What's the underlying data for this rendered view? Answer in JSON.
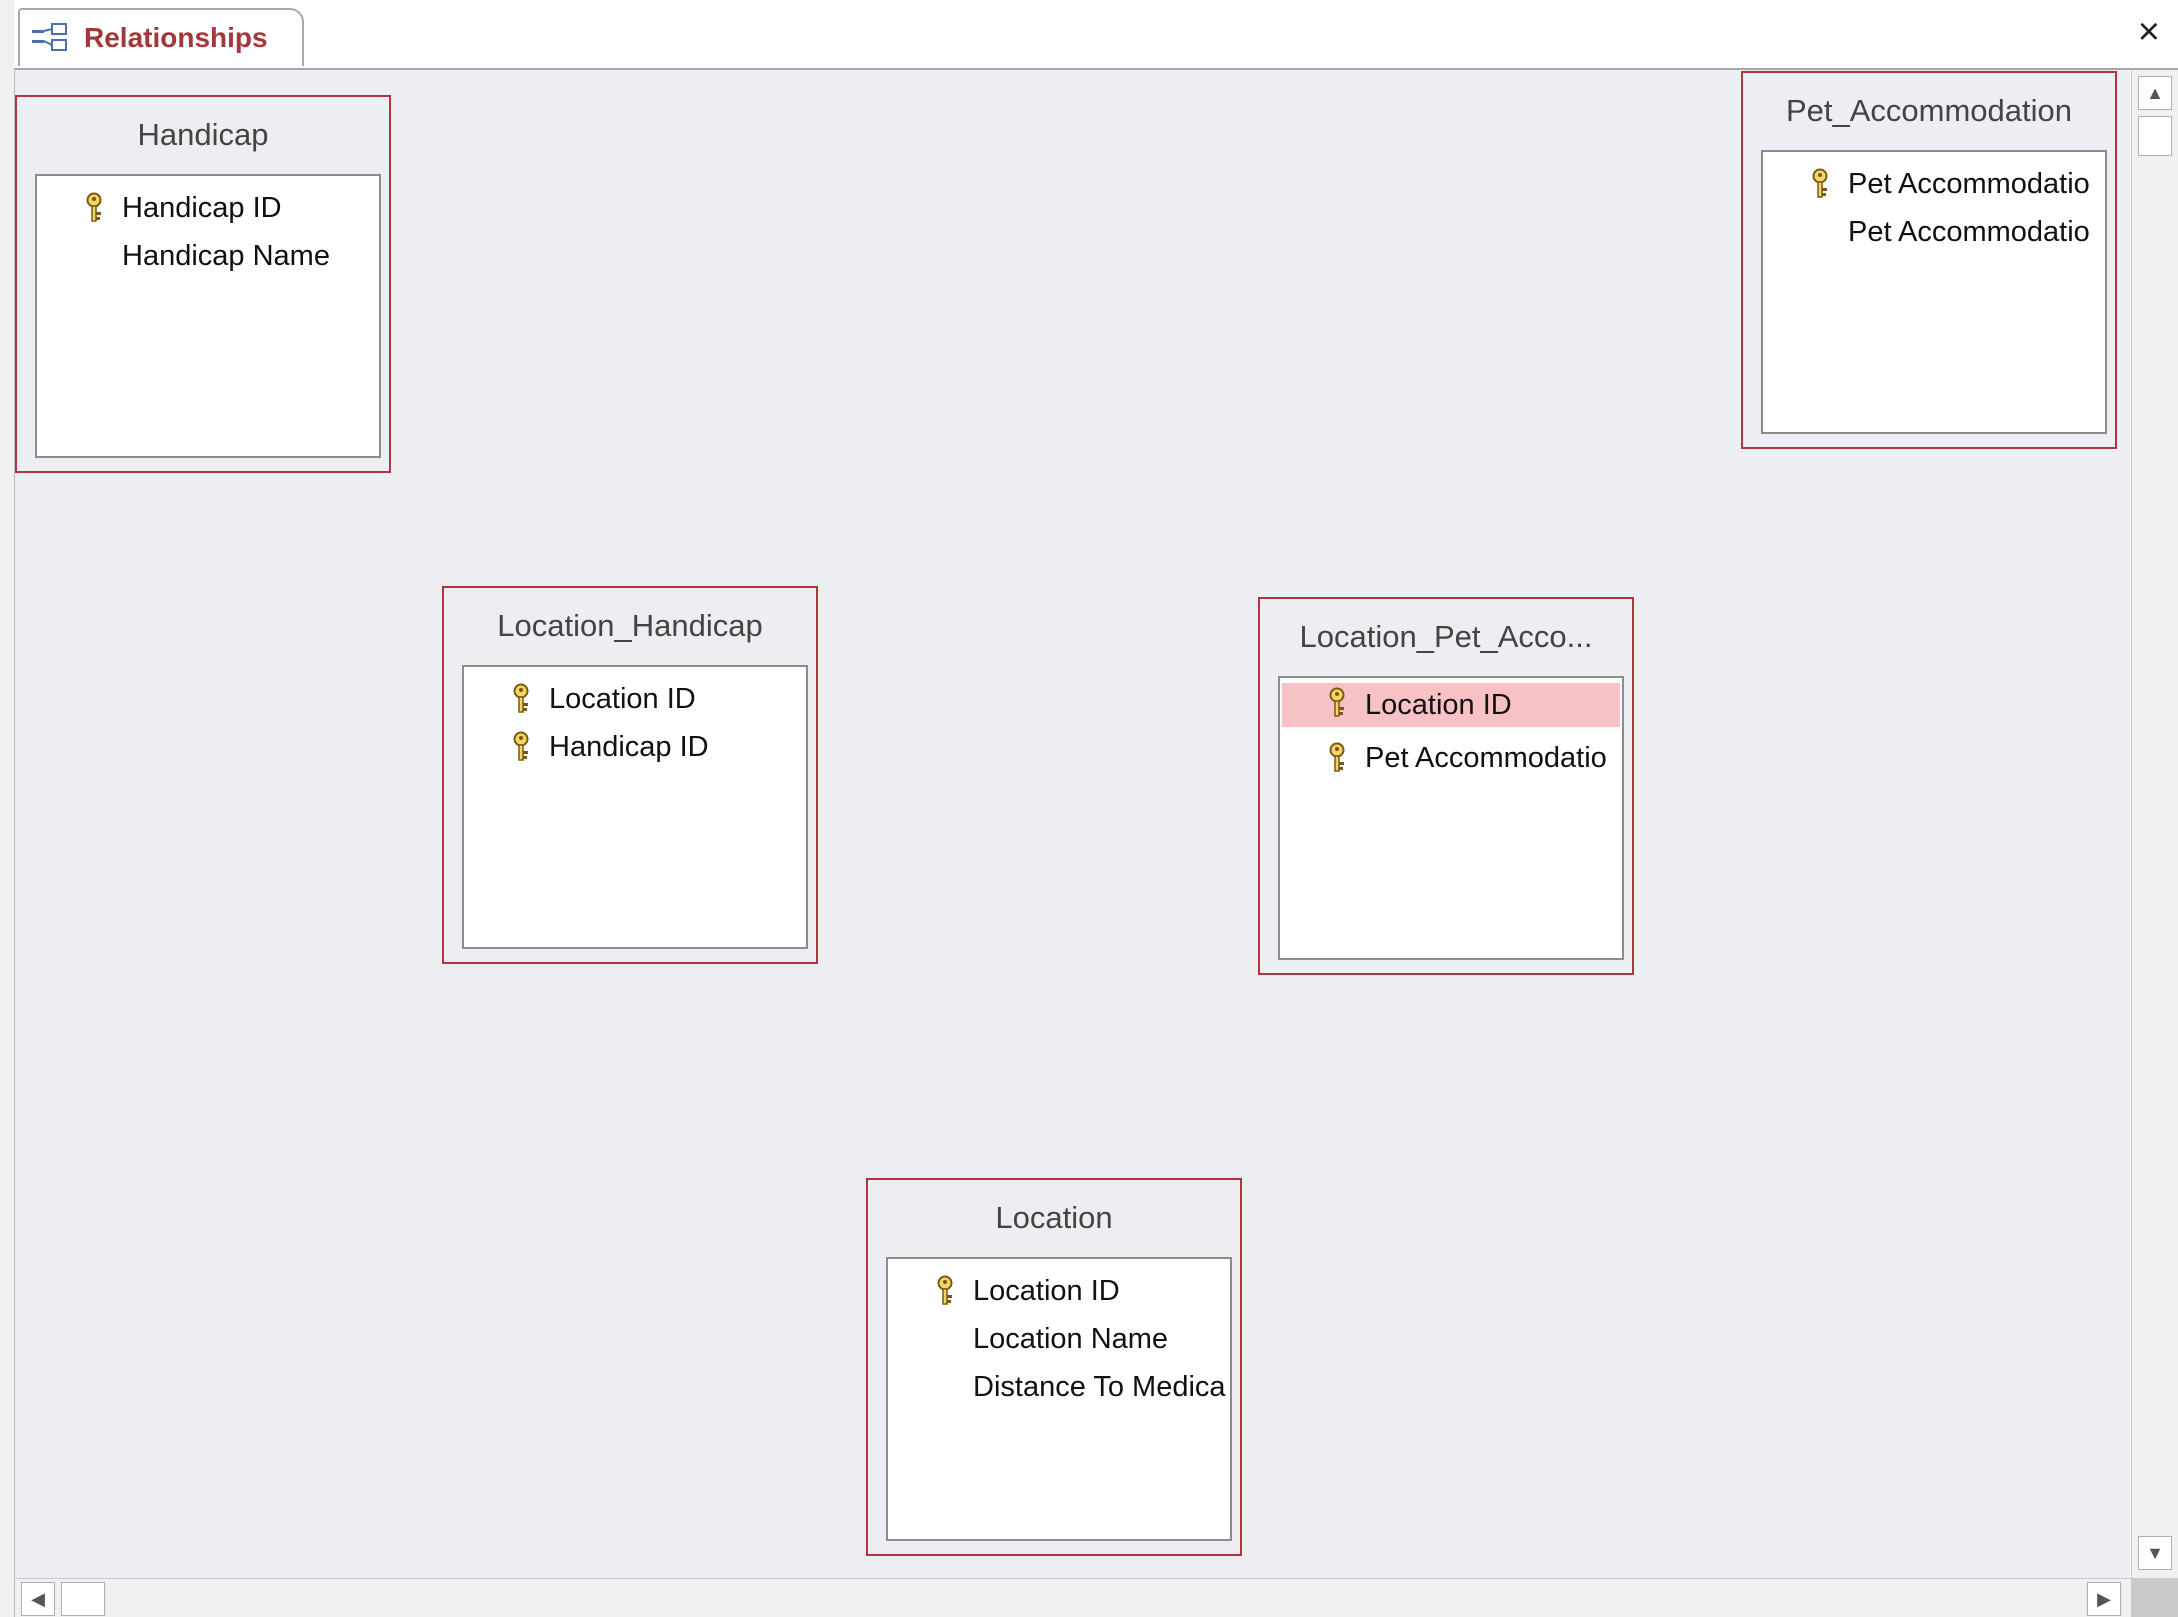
{
  "window": {
    "tab_label": "Relationships",
    "tab_icon": "relationships-icon",
    "close_label": "×",
    "accent_color": "#a4373a",
    "canvas_color": "#eceef1",
    "table_border_color": "#b3343d",
    "selected_row_color": "#f8c2c4"
  },
  "tables": {
    "handicap": {
      "title": "Handicap",
      "fields": [
        {
          "name": "Handicap ID",
          "key": true
        },
        {
          "name": "Handicap Name",
          "key": false
        }
      ]
    },
    "pet_accommodation": {
      "title": "Pet_Accommodation",
      "fields": [
        {
          "name": "Pet Accommodatio",
          "key": true
        },
        {
          "name": "Pet Accommodatio",
          "key": false
        }
      ]
    },
    "location_handicap": {
      "title": "Location_Handicap",
      "fields": [
        {
          "name": "Location ID",
          "key": true
        },
        {
          "name": "Handicap ID",
          "key": true
        }
      ]
    },
    "location_pet_acco": {
      "title": "Location_Pet_Acco...",
      "fields": [
        {
          "name": "Location ID",
          "key": true,
          "selected": true
        },
        {
          "name": "Pet Accommodatio",
          "key": true
        }
      ]
    },
    "location": {
      "title": "Location",
      "fields": [
        {
          "name": "Location ID",
          "key": true
        },
        {
          "name": "Location Name",
          "key": false
        },
        {
          "name": "Distance To Medica",
          "key": false
        }
      ]
    }
  },
  "scrollbars": {
    "up_arrow": "▲",
    "down_arrow": "▼",
    "left_arrow": "◀",
    "right_arrow": "▶"
  }
}
